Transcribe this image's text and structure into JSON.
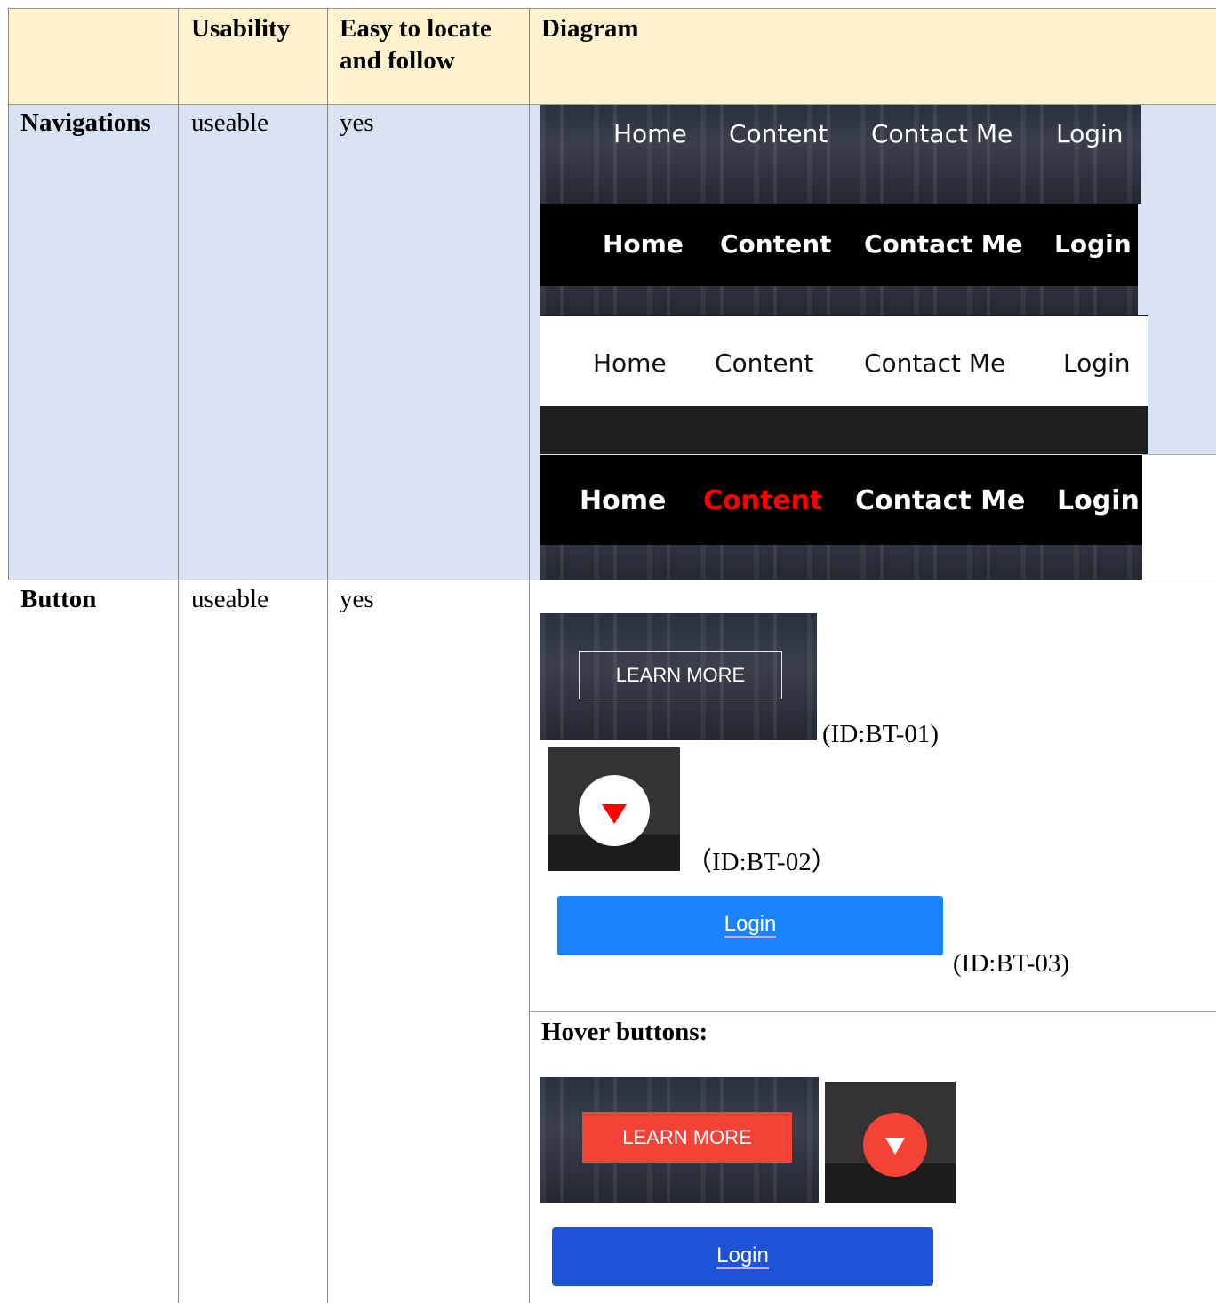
{
  "table": {
    "headers": [
      "",
      "Usability",
      "Easy to locate and follow",
      "Diagram"
    ],
    "rows": [
      {
        "name": "Navigations",
        "usability": "useable",
        "easy": "yes"
      },
      {
        "name": "Button",
        "usability": "useable",
        "easy": "yes"
      }
    ]
  },
  "nav_menus": [
    {
      "items": [
        "Home",
        "Content",
        "Contact Me",
        "Login"
      ],
      "style": "dark-transparent"
    },
    {
      "items": [
        "Home",
        "Content",
        "Contact Me",
        "Login"
      ],
      "style": "black"
    },
    {
      "items": [
        "Home",
        "Content",
        "Contact Me",
        "Login"
      ],
      "style": "white"
    },
    {
      "items": [
        "Home",
        "Content",
        "Contact Me",
        "Login"
      ],
      "style": "black-active",
      "active_item": "Content",
      "active_color": "#ff0000"
    }
  ],
  "buttons": {
    "learn_more": "LEARN MORE",
    "bt01_id": "(ID:BT-01)",
    "bt02_id": "（ID:BT-02）",
    "login": "Login",
    "bt03_id": "(ID:BT-03)",
    "hover_heading": "Hover buttons:",
    "hover_learn_more": "LEARN MORE",
    "hover_login": "Login",
    "colors": {
      "login": "#1a82fb",
      "hover_login": "#1d53d6",
      "hover_red": "#f44336",
      "arrow_red": "#ff0000"
    }
  }
}
